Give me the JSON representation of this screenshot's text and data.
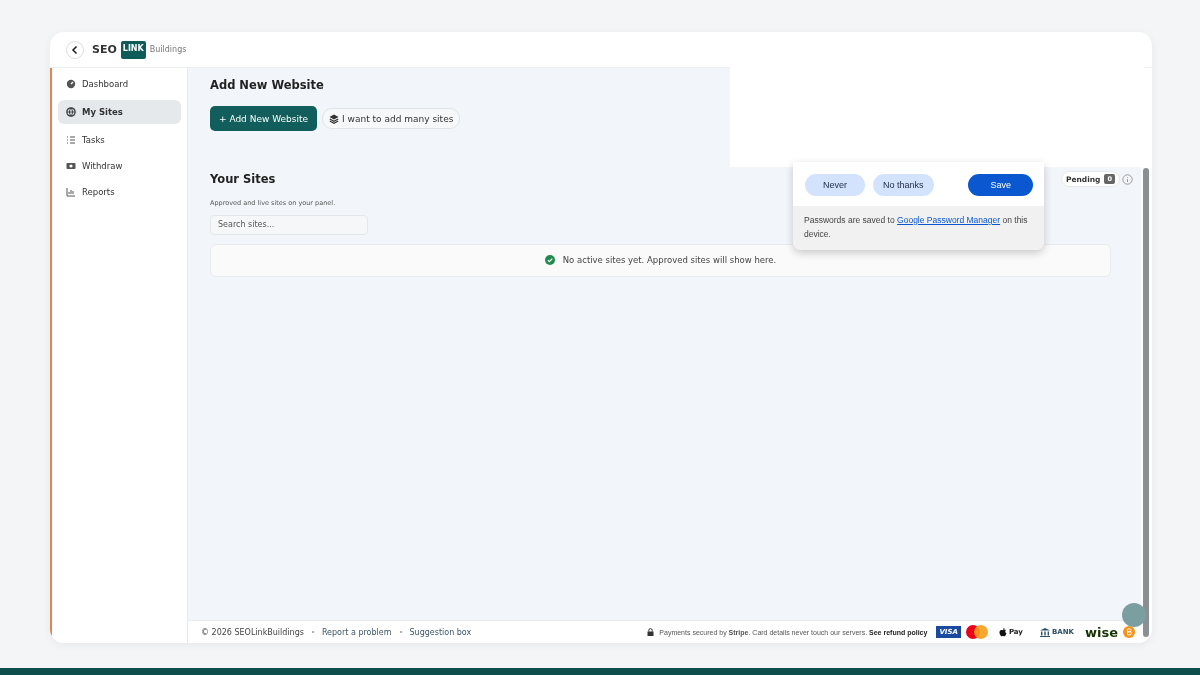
{
  "header": {
    "logo": {
      "part_1": "SEO",
      "part_2": "LINK",
      "part_3": "Buildings"
    }
  },
  "sidebar": {
    "items": [
      {
        "label": "Dashboard",
        "kind": "gauge",
        "selected": false
      },
      {
        "label": "My Sites",
        "kind": "globe",
        "selected": true
      },
      {
        "label": "Tasks",
        "kind": "list",
        "selected": false
      },
      {
        "label": "Withdraw",
        "kind": "cash",
        "selected": false
      },
      {
        "label": "Reports",
        "kind": "chart",
        "selected": false
      }
    ]
  },
  "add_section": {
    "title": "Add New Website",
    "primary_button": "+ Add New Website",
    "secondary_button": "I want to add many sites"
  },
  "sites_section": {
    "title": "Your Sites",
    "subtitle": "Approved and live sites on your panel.",
    "search": {
      "placeholder": "Search sites..."
    },
    "empty_message": "No active sites yet. Approved sites will show here.",
    "pending": {
      "label": "Pending",
      "count": "0"
    }
  },
  "password_prompt": {
    "buttons": [
      {
        "label": "Never",
        "kind": "secondary"
      },
      {
        "label": "No thanks",
        "kind": "secondary"
      },
      {
        "label": "Save",
        "kind": "primary"
      }
    ],
    "note_before": "Passwords are saved to",
    "note_link": "Google Password Manager",
    "note_after": "on this device."
  },
  "footer": {
    "copyright": "© 2026 SEOLinkBuildings",
    "links": [
      "Report a problem",
      "Suggestion box"
    ],
    "payment_note_before": "Payments secured by",
    "payment_brand": "Stripe",
    "payment_note_after": ". Card details never touch our servers.",
    "refund_link": "See refund policy",
    "payment_logos": [
      {
        "label": "VISA",
        "kind": "visa"
      },
      {
        "kind": "mastercard"
      },
      {
        "label": "Pay",
        "kind": "applepay"
      },
      {
        "label": "BANK",
        "kind": "bank"
      },
      {
        "label": "wise",
        "kind": "wise"
      },
      {
        "kind": "bitcoin"
      }
    ]
  }
}
